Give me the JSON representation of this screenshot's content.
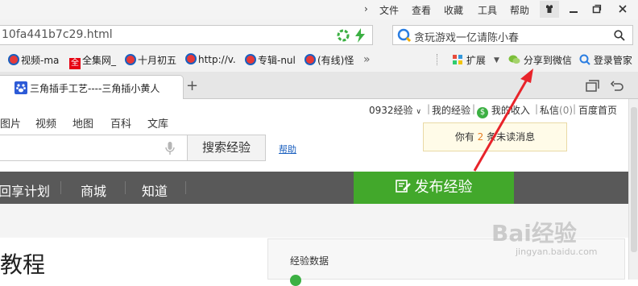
{
  "menubar": {
    "items": [
      "文件",
      "查看",
      "收藏",
      "工具",
      "帮助"
    ]
  },
  "address": {
    "url_fragment": "10fa441b7c29.html",
    "search_placeholder": "贪玩游戏一亿请陈小春"
  },
  "bookmarks": [
    {
      "label": "视频-ma"
    },
    {
      "label": "全集网_"
    },
    {
      "label": "十月初五"
    },
    {
      "label": "http://v."
    },
    {
      "label": "专辑-nul"
    },
    {
      "label": "(有线)怪"
    }
  ],
  "bookmarks_more": "»",
  "toolbar_right": {
    "extensions": "扩展",
    "share_wechat": "分享到微信",
    "login_manager": "登录管家"
  },
  "tab": {
    "title": "三角插手工艺----三角插小黄人",
    "new_tab": "+"
  },
  "page": {
    "user_links": {
      "username": "0932经验",
      "my_experience": "我的经验",
      "my_income": "我的收入",
      "messages": "私信",
      "messages_count": "(0)",
      "home": "百度首页"
    },
    "categories": [
      "图片",
      "视频",
      "地图",
      "百科",
      "文库"
    ],
    "search_button": "搜索经验",
    "help_link": "帮助",
    "nav": [
      "回享计划",
      "商城",
      "知道"
    ],
    "publish_button": "发布经验",
    "tooltip": {
      "prefix": "你有",
      "count": "2",
      "suffix": "条未读消息"
    },
    "heading_fragment": "教程",
    "panel_title": "经验数据"
  },
  "watermark": {
    "text": "Bai经验",
    "sub": "jingyan.baidu.com"
  },
  "colors": {
    "publish_green": "#42a82b",
    "nav_dark": "#595959",
    "arrow_red": "#e8232a"
  }
}
